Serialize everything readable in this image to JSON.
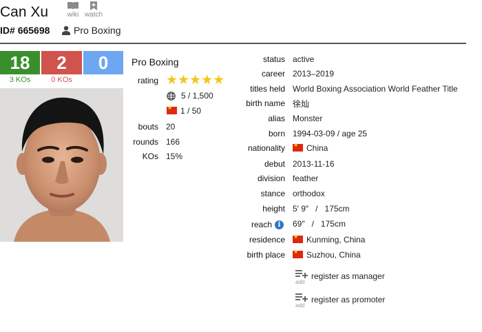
{
  "header": {
    "name": "Can Xu",
    "wiki_label": "wiki",
    "watch_label": "watch",
    "id_prefix": "ID#",
    "id_number": "665698",
    "sport": "Pro Boxing"
  },
  "record": {
    "wins": "18",
    "losses": "2",
    "draws": "0",
    "wins_ko": "3 KOs",
    "losses_ko": "0 KOs",
    "colors": {
      "win": "#3a8f2c",
      "loss": "#d0534e",
      "draw": "#6ea6f2"
    }
  },
  "summary": {
    "heading": "Pro Boxing",
    "rating_label": "rating",
    "rating_stars": 5,
    "world_rank": "5 / 1,500",
    "country_rank": "1 / 50",
    "bouts_label": "bouts",
    "bouts": "20",
    "rounds_label": "rounds",
    "rounds": "166",
    "kos_label": "KOs",
    "kos": "15%"
  },
  "details": {
    "status": {
      "label": "status",
      "value": "active"
    },
    "career": {
      "label": "career",
      "value": "2013–2019"
    },
    "titles": {
      "label": "titles held",
      "value": "World Boxing Association World Feather Title"
    },
    "birth_name": {
      "label": "birth name",
      "value": "徐灿"
    },
    "alias": {
      "label": "alias",
      "value": "Monster"
    },
    "born": {
      "label": "born",
      "value": "1994-03-09 / age 25"
    },
    "nationality": {
      "label": "nationality",
      "value": "China"
    },
    "debut": {
      "label": "debut",
      "value": "2013-11-16"
    },
    "division": {
      "label": "division",
      "value": "feather"
    },
    "stance": {
      "label": "stance",
      "value": "orthodox"
    },
    "height": {
      "label": "height",
      "value": "5′ 9″   /   175cm"
    },
    "reach": {
      "label": "reach",
      "value": "69″   /   175cm"
    },
    "residence": {
      "label": "residence",
      "value": "Kunming, China"
    },
    "birth_place": {
      "label": "birth place",
      "value": "Suzhou, China"
    }
  },
  "actions": {
    "add_label": "add",
    "manager": "register as manager",
    "promoter": "register as promoter"
  }
}
